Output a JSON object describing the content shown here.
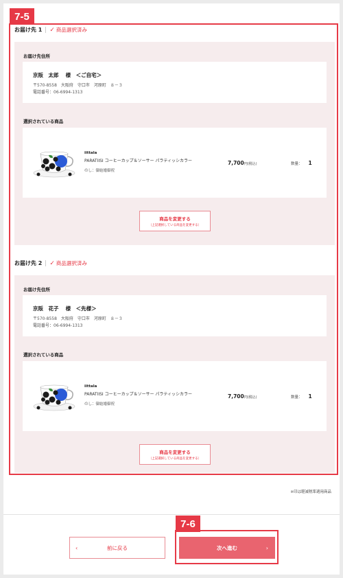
{
  "annotations": {
    "tag_a": "7-5",
    "tag_b": "7-6"
  },
  "destinations": [
    {
      "heading": "お届け先 1",
      "status": "商品選択済み",
      "address_label": "お届け先住所",
      "name": "京阪　太郎　 様　＜ご自宅＞",
      "postal_address": "〒570-8558　大阪府　守口市　河原町　８－３",
      "phone": "電話番号：06-6994-1313",
      "products_label": "選択されている商品",
      "product": {
        "brand": "iittala",
        "name": "PARATIISI コーヒーカップ＆ソーサー パラティッシカラー",
        "noshi": "のし：御結婚御祝",
        "price": "7,700",
        "price_unit": "円(税込)",
        "qty_label": "数量：",
        "qty": "1"
      },
      "change_button": {
        "line1": "商品を変更する",
        "line2": "（上記選択している商品を変更する）"
      }
    },
    {
      "heading": "お届け先 2",
      "status": "商品選択済み",
      "address_label": "お届け先住所",
      "name": "京阪　花子　 様　＜先様＞",
      "postal_address": "〒570-8558　大阪府　守口市　河原町　８－３",
      "phone": "電話番号：06-6994-1313",
      "products_label": "選択されている商品",
      "product": {
        "brand": "iittala",
        "name": "PARATIISI コーヒーカップ＆ソーサー パラティッシカラー",
        "noshi": "のし：御結婚御祝",
        "price": "7,700",
        "price_unit": "円(税込)",
        "qty_label": "数量：",
        "qty": "1"
      },
      "change_button": {
        "line1": "商品を変更する",
        "line2": "（上記選択している商品を変更する）"
      }
    }
  ],
  "tax_note": "※印は軽減税率適用商品",
  "nav": {
    "back_label": "前に戻る",
    "back_arrow": "‹",
    "next_label": "次へ進む",
    "next_arrow": "›"
  },
  "colors": {
    "accent": "#e63946",
    "panel_bg": "#f6eced",
    "next_button_bg": "#e9646f"
  }
}
